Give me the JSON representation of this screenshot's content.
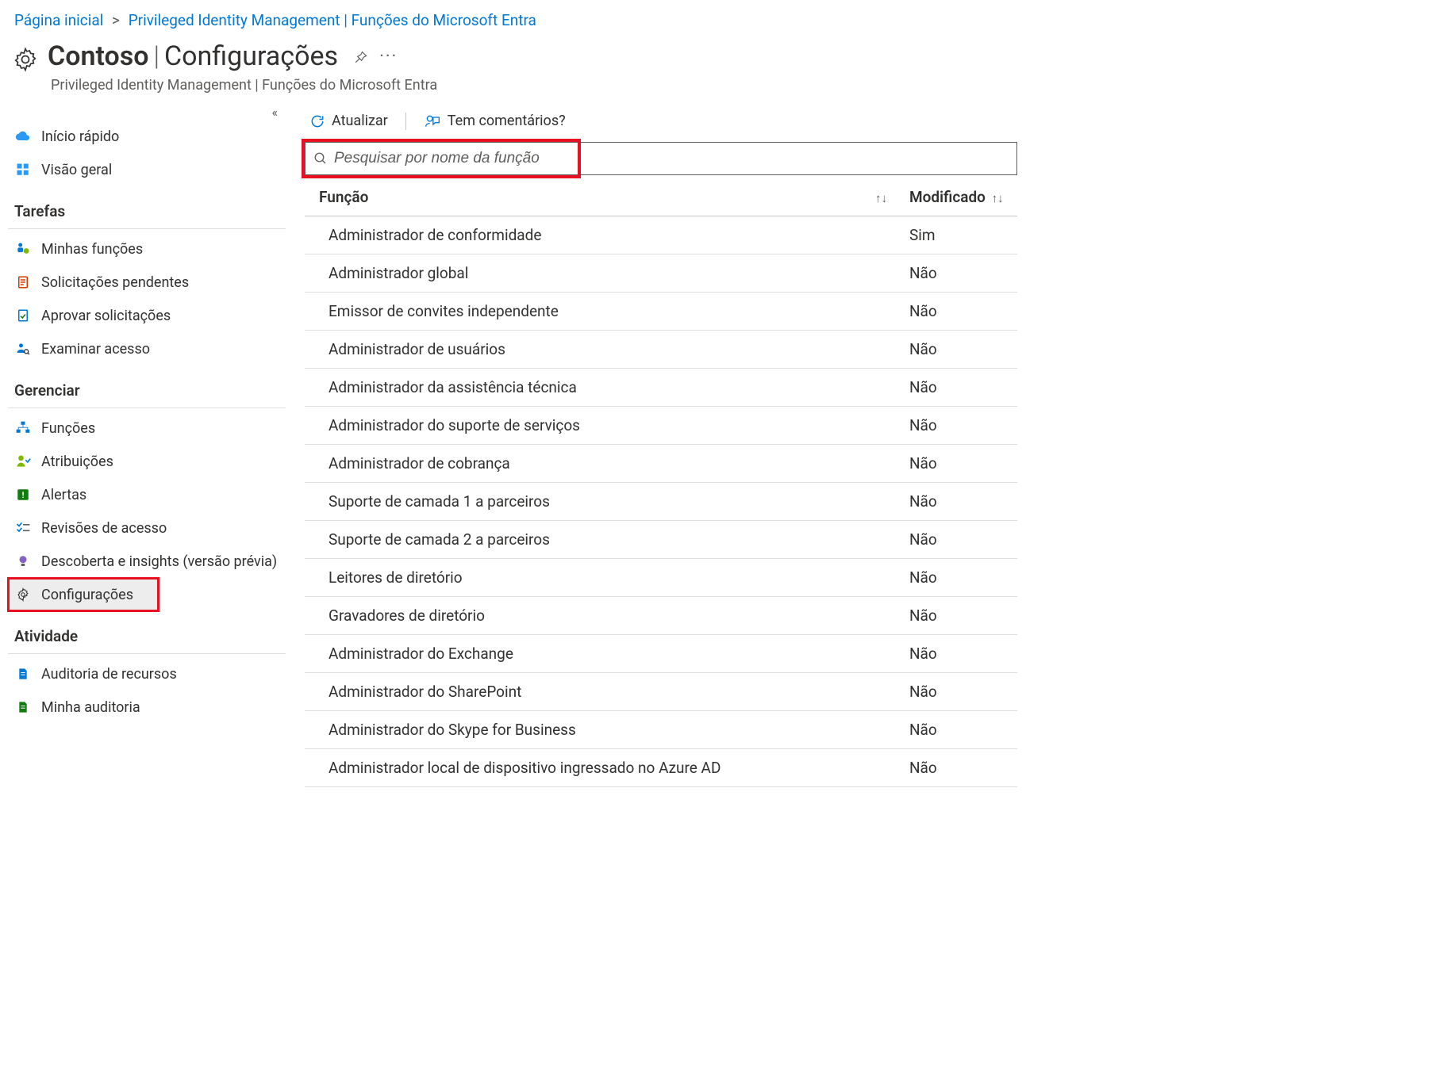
{
  "breadcrumb": {
    "home": "Página inicial",
    "pim": "Privileged Identity Management | Funções do Microsoft Entra"
  },
  "header": {
    "tenant": "Contoso",
    "title": "Configurações",
    "subtitle": "Privileged Identity Management | Funções do Microsoft Entra"
  },
  "sidebar": {
    "quickstart": "Início rápido",
    "overview": "Visão geral",
    "section_tasks": "Tarefas",
    "my_roles": "Minhas funções",
    "pending_requests": "Solicitações pendentes",
    "approve_requests": "Aprovar solicitações",
    "review_access": "Examinar acesso",
    "section_manage": "Gerenciar",
    "roles": "Funções",
    "assignments": "Atribuições",
    "alerts": "Alertas",
    "access_reviews": "Revisões de acesso",
    "discovery": "Descoberta e insights (versão prévia)",
    "settings": "Configurações",
    "section_activity": "Atividade",
    "resource_audit": "Auditoria de recursos",
    "my_audit": "Minha auditoria"
  },
  "toolbar": {
    "refresh": "Atualizar",
    "feedback": "Tem comentários?"
  },
  "search": {
    "placeholder": "Pesquisar por nome da função"
  },
  "table": {
    "col_role": "Função",
    "col_modified": "Modificado",
    "rows": [
      {
        "role": "Administrador de conformidade",
        "modified": "Sim"
      },
      {
        "role": "Administrador global",
        "modified": "Não"
      },
      {
        "role": "Emissor de convites independente",
        "modified": "Não"
      },
      {
        "role": "Administrador de usuários",
        "modified": "Não"
      },
      {
        "role": "Administrador da assistência técnica",
        "modified": "Não"
      },
      {
        "role": "Administrador do suporte de serviços",
        "modified": "Não"
      },
      {
        "role": "Administrador de cobrança",
        "modified": "Não"
      },
      {
        "role": "Suporte de camada 1 a parceiros",
        "modified": "Não"
      },
      {
        "role": "Suporte de camada 2 a parceiros",
        "modified": "Não"
      },
      {
        "role": "Leitores de diretório",
        "modified": "Não"
      },
      {
        "role": "Gravadores de diretório",
        "modified": "Não"
      },
      {
        "role": "Administrador do Exchange",
        "modified": "Não"
      },
      {
        "role": "Administrador do SharePoint",
        "modified": "Não"
      },
      {
        "role": "Administrador do Skype for Business",
        "modified": "Não"
      },
      {
        "role": "Administrador local de dispositivo ingressado no Azure AD",
        "modified": "Não"
      }
    ]
  }
}
